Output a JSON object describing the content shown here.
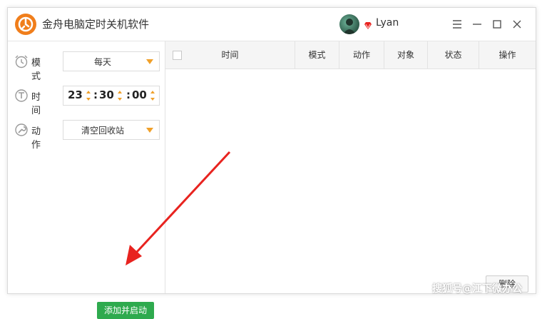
{
  "app": {
    "title": "金舟电脑定时关机软件",
    "accent": "#f07e1b"
  },
  "user": {
    "name": "Lyan"
  },
  "left": {
    "mode": {
      "label": "模式",
      "value": "每天"
    },
    "time": {
      "label": "时间",
      "hour": "23",
      "minute": "30",
      "second": "00"
    },
    "action": {
      "label": "动作",
      "value": "清空回收站"
    },
    "add_button": "添加并启动"
  },
  "table": {
    "columns": [
      "时间",
      "模式",
      "动作",
      "对象",
      "状态",
      "操作"
    ],
    "rows": []
  },
  "delete_button": "删除",
  "watermark": "搜狐号@江下微办公",
  "colors": {
    "green": "#2eaa4e",
    "orange": "#f0a02a",
    "annotation_red": "#e8231f"
  }
}
